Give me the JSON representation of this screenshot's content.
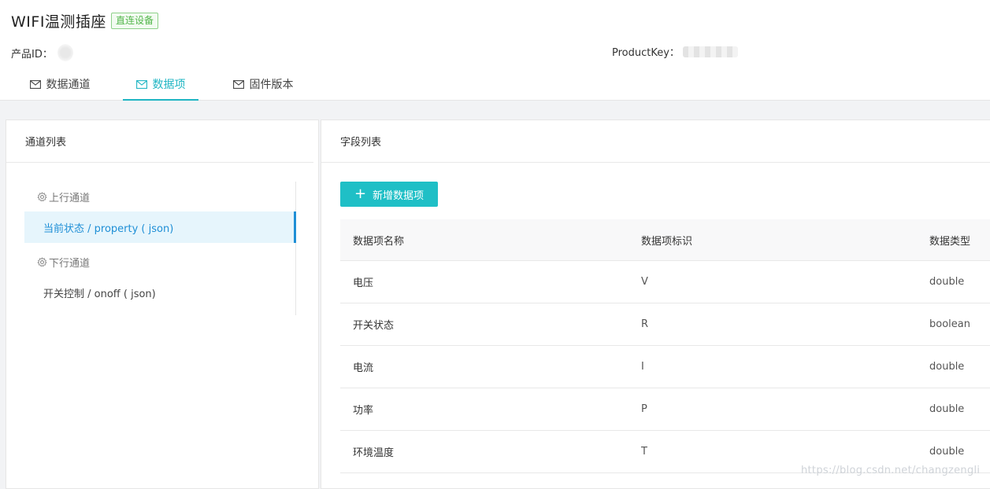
{
  "header": {
    "title": "WIFI温测插座",
    "badge": "直连设备",
    "product_id_label": "产品ID：",
    "product_key_label": "ProductKey："
  },
  "tabs": [
    {
      "label": "数据通道",
      "icon": "mail-icon",
      "active": false
    },
    {
      "label": "数据项",
      "icon": "mail-icon",
      "active": true
    },
    {
      "label": "固件版本",
      "icon": "mail-icon",
      "active": false
    }
  ],
  "left_panel": {
    "title": "通道列表",
    "groups": [
      {
        "label": "上行通道",
        "icon": "gear-icon",
        "items": [
          "当前状态 / property ( json)"
        ]
      },
      {
        "label": "下行通道",
        "icon": "gear-icon",
        "items": [
          "开关控制 / onoff ( json)"
        ]
      }
    ],
    "selected_item": "当前状态 / property ( json)"
  },
  "right_panel": {
    "title": "字段列表",
    "add_button": "新增数据项",
    "columns": [
      "数据项名称",
      "数据项标识",
      "数据类型"
    ],
    "rows": [
      [
        "电压",
        "V",
        "double"
      ],
      [
        "开关状态",
        "R",
        "boolean"
      ],
      [
        "电流",
        "I",
        "double"
      ],
      [
        "功率",
        "P",
        "double"
      ],
      [
        "环境温度",
        "T",
        "double"
      ]
    ]
  },
  "watermark": "https://blog.csdn.net/changzengli",
  "colors": {
    "accent": "#1fb5c3",
    "selected": "#1f8fd6",
    "badge": "#52b64a"
  }
}
